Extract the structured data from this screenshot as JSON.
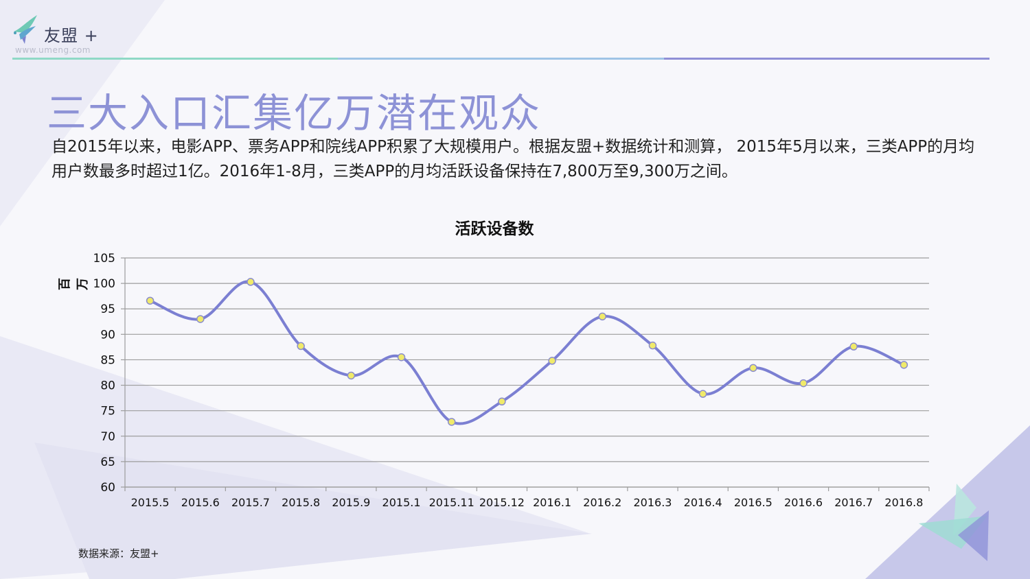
{
  "header": {
    "logo_name": "友盟 +",
    "logo_url": "www.umeng.com",
    "rule_colors": [
      "#8fd9c6",
      "#9fc4e6",
      "#8f8fd6"
    ]
  },
  "slide": {
    "title": "三大入口汇集亿万潜在观众",
    "paragraph": "自2015年以来，电影APP、票务APP和院线APP积累了大规模用户。根据友盟+数据统计和测算， 2015年5月以来，三类APP的月均用户数最多时超过1亿。2016年1-8月，三类APP的月均活跃设备保持在7,800万至9,300万之间。",
    "source": "数据来源：友盟+"
  },
  "colors": {
    "title": "#8d92d6",
    "line": "#7b7fd2",
    "marker_fill": "#f0ea6a",
    "grid": "#9c9c9c"
  },
  "chart_data": {
    "type": "line",
    "title": "活跃设备数",
    "ylabel": "百万",
    "xlabel": "",
    "ylim": [
      60,
      105
    ],
    "yticks": [
      60,
      65,
      70,
      75,
      80,
      85,
      90,
      95,
      100,
      105
    ],
    "grid": true,
    "smooth": true,
    "categories": [
      "2015.5",
      "2015.6",
      "2015.7",
      "2015.8",
      "2015.9",
      "2015.1",
      "2015.11",
      "2015.12",
      "2016.1",
      "2016.2",
      "2016.3",
      "2016.4",
      "2016.5",
      "2016.6",
      "2016.7",
      "2016.8"
    ],
    "series": [
      {
        "values": [
          96.6,
          93.0,
          100.3,
          87.7,
          81.9,
          85.5,
          72.8,
          76.8,
          84.8,
          93.5,
          87.8,
          78.3,
          83.4,
          80.4,
          87.6,
          84.0
        ]
      }
    ]
  }
}
